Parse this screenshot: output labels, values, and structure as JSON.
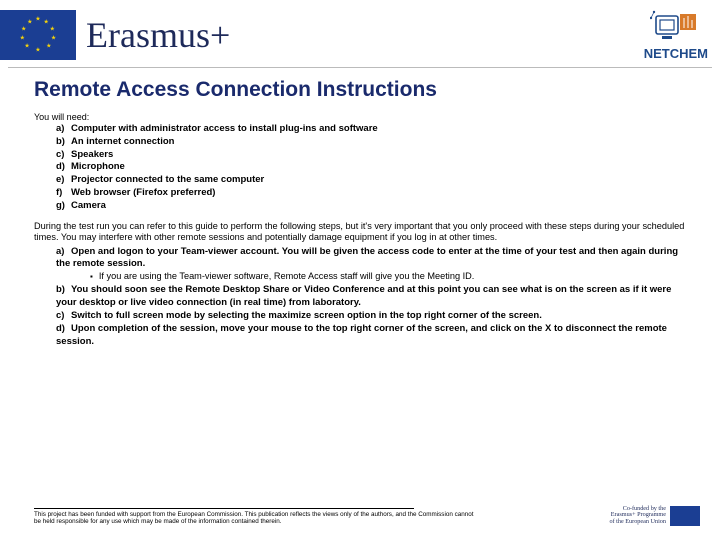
{
  "header": {
    "brand": "Erasmus+",
    "partner": "NETCHEM"
  },
  "title": "Remote Access Connection Instructions",
  "need_intro": "You will need:",
  "requirements": [
    {
      "bullet": "a)",
      "text": "Computer with administrator access to install plug-ins and software"
    },
    {
      "bullet": "b)",
      "text": "An internet connection"
    },
    {
      "bullet": "c)",
      "text": "Speakers"
    },
    {
      "bullet": "d)",
      "text": "Microphone"
    },
    {
      "bullet": "e)",
      "text": "Projector connected to the same computer"
    },
    {
      "bullet": "f)",
      "text": "Web browser (Firefox preferred)"
    },
    {
      "bullet": "g)",
      "text": "Camera"
    }
  ],
  "paragraph": "During the test run you can refer to this guide to perform the following steps, but it's very important that you only proceed with these steps during your scheduled times. You may interfere with other remote sessions and potentially damage equipment if you log in at other times.",
  "steps": [
    {
      "bullet": "a)",
      "text": "Open and logon to your Team-viewer account. You will be given the access code to enter at the time of your test and then again during the remote session."
    },
    {
      "sub": "If you are using the Team-viewer software, Remote Access staff will give you the Meeting ID."
    },
    {
      "bullet": "b)",
      "text": "You should soon see the Remote Desktop Share or Video Conference and at this point you can see what is on the screen as if it were your desktop or live video connection (in real time) from laboratory."
    },
    {
      "bullet": "c)",
      "text": "Switch to full screen mode by selecting the maximize screen option in the top right corner of the screen."
    },
    {
      "bullet": "d)",
      "text": "Upon completion of the session, move your mouse to the top right corner of the screen, and click on the X to disconnect the remote session."
    }
  ],
  "footer": {
    "disclaimer": "This project has been funded with support from the European Commission. This publication reflects the views only of the authors, and the Commission cannot be held responsible for any use which may be made of the information contained therein.",
    "cofund_l1": "Co-funded by the",
    "cofund_l2": "Erasmus+ Programme",
    "cofund_l3": "of the European Union"
  }
}
